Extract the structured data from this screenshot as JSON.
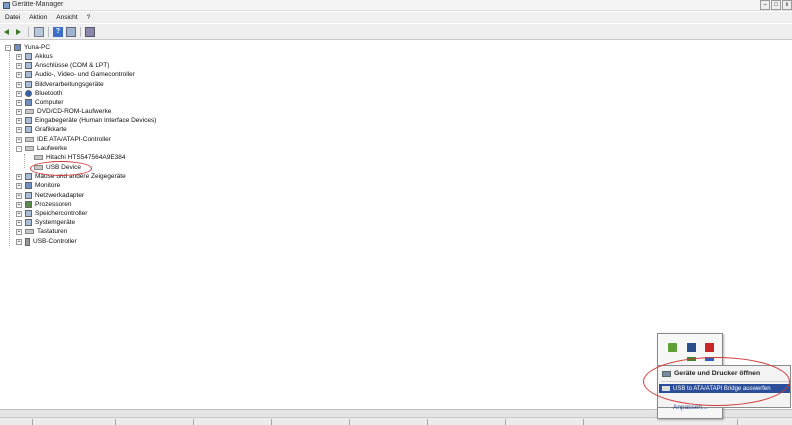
{
  "window": {
    "title": "Geräte-Manager",
    "controls": [
      "–",
      "□",
      "x"
    ]
  },
  "menubar": [
    "Datei",
    "Aktion",
    "Ansicht",
    "?"
  ],
  "tree": {
    "root": "Yuna-PC",
    "nodes": [
      {
        "label": "Akkus",
        "expander": "+"
      },
      {
        "label": "Anschlüsse (COM & LPT)",
        "expander": "+"
      },
      {
        "label": "Audio-, Video- und Gamecontroller",
        "expander": "+"
      },
      {
        "label": "Bildverarbeitungsgeräte",
        "expander": "+"
      },
      {
        "label": "Bluetooth",
        "expander": "+"
      },
      {
        "label": "Computer",
        "expander": "+"
      },
      {
        "label": "DVD/CD-ROM-Laufwerke",
        "expander": "+"
      },
      {
        "label": "Eingabegeräte (Human Interface Devices)",
        "expander": "+"
      },
      {
        "label": "Grafikkarte",
        "expander": "+"
      },
      {
        "label": "IDE ATA/ATAPI-Controller",
        "expander": "+"
      },
      {
        "label": "Laufwerke",
        "expander": "-"
      },
      {
        "label": "Hitachi HTS547564A9E384",
        "child": true
      },
      {
        "label": "USB Device",
        "child": true
      },
      {
        "label": "Mäuse und andere Zeigegeräte",
        "expander": "+"
      },
      {
        "label": "Monitore",
        "expander": "+"
      },
      {
        "label": "Netzwerkadapter",
        "expander": "+"
      },
      {
        "label": "Prozessoren",
        "expander": "+"
      },
      {
        "label": "Speichercontroller",
        "expander": "+"
      },
      {
        "label": "Systemgeräte",
        "expander": "+"
      },
      {
        "label": "Tastaturen",
        "expander": "+"
      },
      {
        "label": "USB-Controller",
        "expander": "+"
      }
    ]
  },
  "context_menu": {
    "item1": "Geräte und Drucker öffnen",
    "item2": "USB to ATA/ATAPI Bridge auswerfen"
  },
  "tray": {
    "customize": "Anpassen..."
  },
  "colors": {
    "annotation": "#d23b3b",
    "selection": "#2a4e9a"
  }
}
